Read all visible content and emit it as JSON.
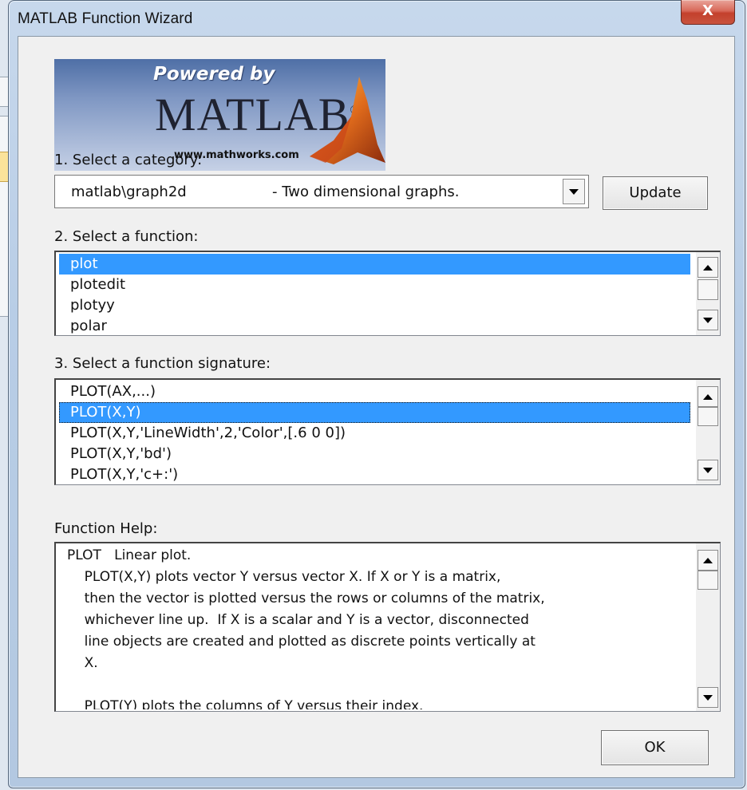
{
  "window": {
    "title": "MATLAB Function Wizard",
    "close_label": "X"
  },
  "logo": {
    "powered_by": "Powered by",
    "brand": "MATLAB",
    "registered": "®",
    "url": "www.mathworks.com"
  },
  "category": {
    "label": "1. Select a category:",
    "selected_name": "matlab\\graph2d",
    "selected_desc": "- Two dimensional graphs.",
    "update_label": "Update"
  },
  "function": {
    "label": "2. Select a function:",
    "items": [
      "plot",
      "plotedit",
      "plotyy",
      "polar"
    ],
    "selected_index": 0
  },
  "signature": {
    "label": "3. Select a function signature:",
    "items": [
      "PLOT(AX,...)",
      "PLOT(X,Y)",
      "PLOT(X,Y,'LineWidth',2,'Color',[.6 0 0])",
      "PLOT(X,Y,'bd')",
      "PLOT(X,Y,'c+:')"
    ],
    "selected_index": 1
  },
  "help": {
    "label": "Function Help:",
    "lines": [
      "PLOT   Linear plot.",
      "    PLOT(X,Y) plots vector Y versus vector X. If X or Y is a matrix,",
      "    then the vector is plotted versus the rows or columns of the matrix,",
      "    whichever line up.  If X is a scalar and Y is a vector, disconnected",
      "    line objects are created and plotted as discrete points vertically at",
      "    X.",
      "",
      "    PLOT(Y) plots the columns of Y versus their index."
    ]
  },
  "footer": {
    "ok_label": "OK"
  },
  "colors": {
    "selection": "#3399ff",
    "close_button": "#c3402c",
    "dialog_bg": "#f0f0f0"
  }
}
